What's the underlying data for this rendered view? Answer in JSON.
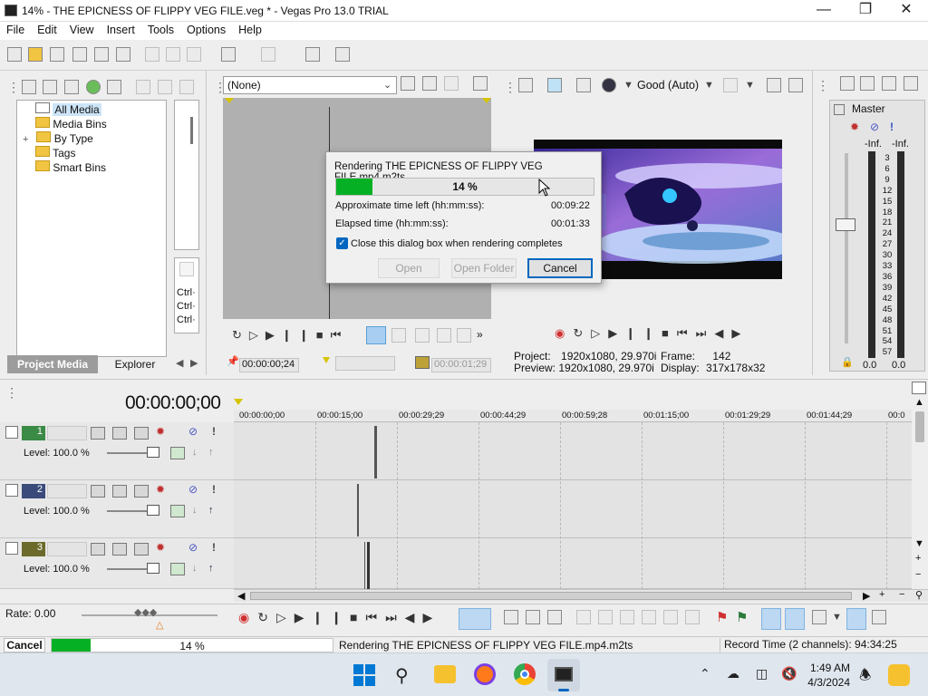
{
  "window": {
    "title": "14% - THE EPICNESS OF FLIPPY VEG FILE.veg * - Vegas Pro 13.0 TRIAL"
  },
  "menu": [
    "File",
    "Edit",
    "View",
    "Insert",
    "Tools",
    "Options",
    "Help"
  ],
  "media_tree": {
    "items": [
      {
        "label": "All Media",
        "selected": true,
        "expander": ""
      },
      {
        "label": "Media Bins",
        "expander": ""
      },
      {
        "label": "By Type",
        "expander": "+"
      },
      {
        "label": "Tags",
        "expander": ""
      },
      {
        "label": "Smart Bins",
        "expander": ""
      }
    ]
  },
  "ctrl_labels": [
    "Ctrl·",
    "Ctrl·",
    "Ctrl·"
  ],
  "tabs": {
    "project_media": "Project Media",
    "explorer": "Explorer"
  },
  "trimmer": {
    "preset": "(None)",
    "time_in": "00:00:00;24",
    "time_out": "00:00:01;29"
  },
  "preview": {
    "quality": "Good (Auto)",
    "project_label": "Project:",
    "project_value": "1920x1080, 29.970i",
    "preview_label": "Preview:",
    "preview_value": "1920x1080, 29.970i",
    "frame_label": "Frame:",
    "frame_value": "142",
    "display_label": "Display:",
    "display_value": "317x178x32"
  },
  "master": {
    "title": "Master",
    "left_peak": "-Inf.",
    "right_peak": "-Inf.",
    "scale": [
      "3",
      "6",
      "9",
      "12",
      "15",
      "18",
      "21",
      "24",
      "27",
      "30",
      "33",
      "36",
      "39",
      "42",
      "45",
      "48",
      "51",
      "54",
      "57"
    ],
    "left_level": "0.0",
    "right_level": "0.0"
  },
  "dialog": {
    "title": "Rendering THE EPICNESS OF FLIPPY VEG FILE.mp4.m2ts",
    "progress_text": "14 %",
    "progress": 0.14,
    "time_left_label": "Approximate time left (hh:mm:ss):",
    "time_left": "00:09:22",
    "elapsed_label": "Elapsed time (hh:mm:ss):",
    "elapsed": "00:01:33",
    "close_checkbox": "Close this dialog box when rendering completes",
    "open": "Open",
    "open_folder": "Open Folder",
    "cancel": "Cancel"
  },
  "timeline": {
    "cursor_time": "00:00:00;00",
    "ruler": [
      "00:00:00;00",
      "00:00:15;00",
      "00:00:29;29",
      "00:00:44;29",
      "00:00:59;28",
      "00:01:15;00",
      "00:01:29;29",
      "00:01:44;29",
      "00:0"
    ],
    "tracks": [
      {
        "number": "1",
        "level": "Level: 100.0 %"
      },
      {
        "number": "2",
        "level": "Level: 100.0 %"
      },
      {
        "number": "3",
        "level": "Level: 100.0 %"
      }
    ],
    "rate": "Rate: 0.00"
  },
  "status": {
    "cancel": "Cancel",
    "progress_text": "14 %",
    "progress": 0.14,
    "message": "Rendering THE EPICNESS OF FLIPPY VEG FILE.mp4.m2ts",
    "record_time": "Record Time (2 channels): 94:34:25"
  },
  "taskbar": {
    "time": "1:49 AM",
    "date": "4/3/2024"
  },
  "colors": {
    "progress_green": "#06b025",
    "accent_blue": "#0067c0",
    "timeline_bg": "#e3e3e3"
  }
}
